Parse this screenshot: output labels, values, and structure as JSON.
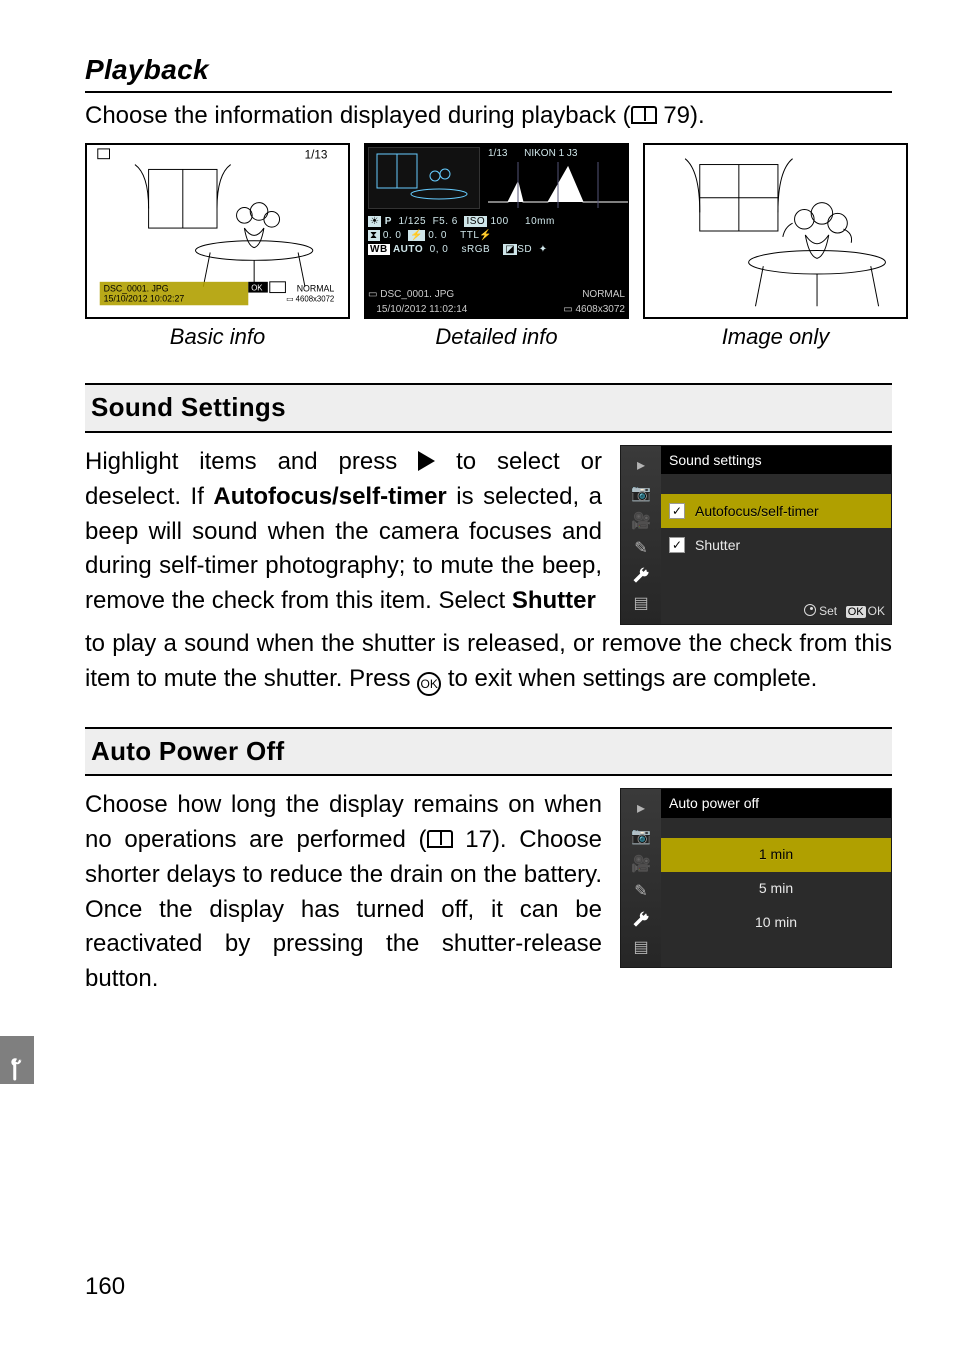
{
  "page_number": "160",
  "playback": {
    "heading": "Playback",
    "lead_pre": "Choose the information displayed during playback (",
    "lead_ref": "79",
    "lead_post": ").",
    "thumbs": {
      "basic": {
        "caption": "Basic info"
      },
      "detailed": {
        "caption": "Detailed info"
      },
      "image": {
        "caption": "Image only"
      }
    },
    "detailed_shot": {
      "counter": "1/13",
      "model": "NIKON 1 J3",
      "row1": {
        "mode": "P",
        "shutter": "1/125",
        "aperture": "F5. 6",
        "iso_lbl": "ISO",
        "iso": "100",
        "fl": "10mm"
      },
      "row2": {
        "ev": "0. 0",
        "flashcomp": "0. 0",
        "flash": "TTL"
      },
      "row3": {
        "wb": "AUTO",
        "wbadj": "0, 0",
        "cs": "sRGB",
        "pc": "SD"
      },
      "file": "DSC_0001. JPG",
      "date": "15/10/2012 11:02:14",
      "qual": "NORMAL",
      "size": "4608x3072"
    }
  },
  "sound": {
    "heading": "Sound Settings",
    "p_pre": "Highlight items and press ",
    "p_mid1": " to select or deselect. If ",
    "p_bold1": "Autofocus/self-timer",
    "p_mid2": " is selected, a beep will sound when the camera focuses and during self-timer photography; to mute the beep, remove the check from this item. Select ",
    "p_bold2": "Shutter",
    "p2_pre": " to play a sound when the shutter is released, or remove the check from this item to mute the shutter. Press ",
    "p2_post": " to exit when settings are complete.",
    "menu": {
      "title": "Sound settings",
      "item1": "Autofocus/self-timer",
      "item2": "Shutter",
      "foot_set": "Set",
      "foot_ok": "OK"
    }
  },
  "auto": {
    "heading": "Auto Power Off",
    "p_pre": "Choose how long the display remains on when no operations are performed (",
    "p_ref": "17",
    "p_post": "). Choose shorter delays to reduce the drain on the battery. Once the display has turned off, it can be reactivated by pressing the shutter-release button.",
    "menu": {
      "title": "Auto power off",
      "opt1": "1 min",
      "opt2": "5 min",
      "opt3": "10 min"
    }
  }
}
